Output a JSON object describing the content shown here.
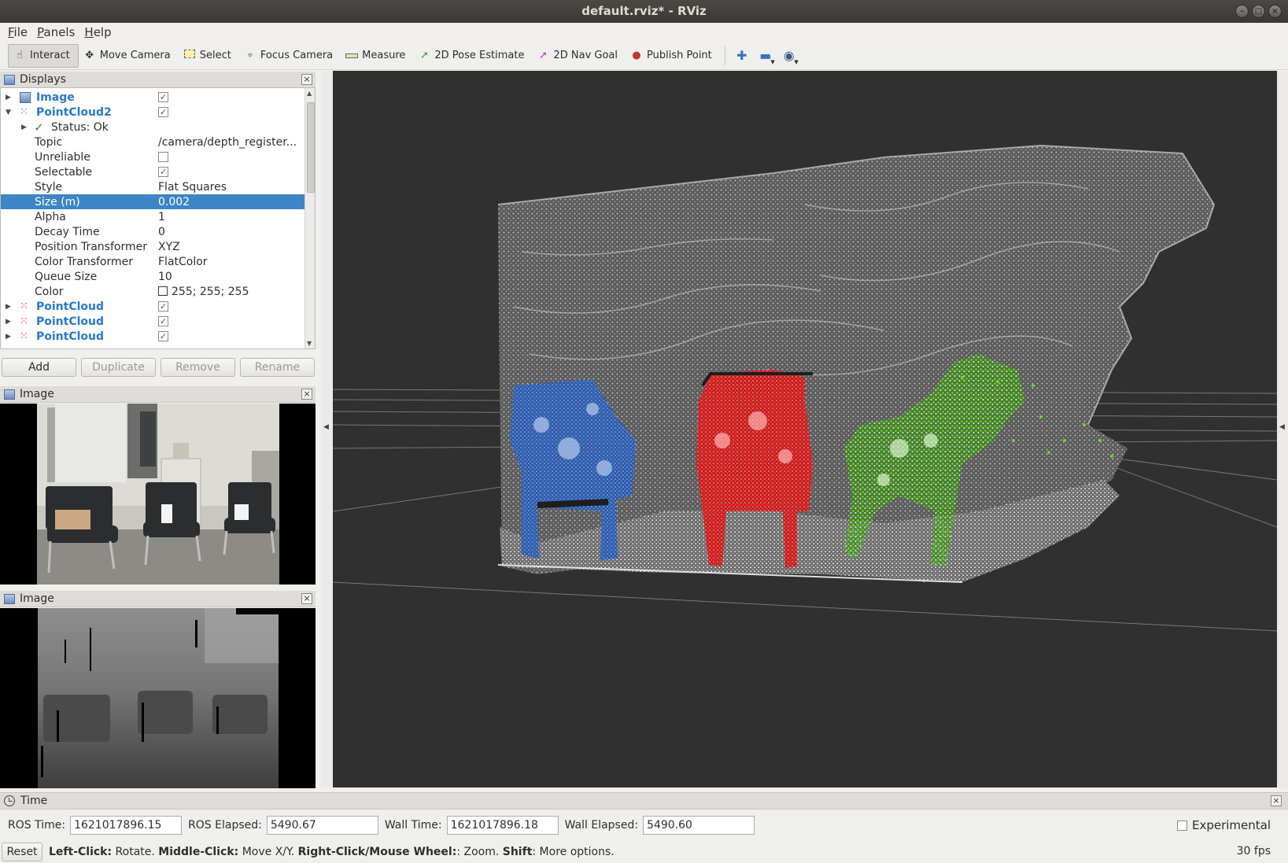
{
  "window": {
    "title": "default.rviz* - RViz"
  },
  "menu": [
    "File",
    "Panels",
    "Help"
  ],
  "toolbar": {
    "tools": [
      {
        "label": "Interact",
        "icon": "hand-icon"
      },
      {
        "label": "Move Camera",
        "icon": "move-camera-icon"
      },
      {
        "label": "Select",
        "icon": "select-box-icon"
      },
      {
        "label": "Focus Camera",
        "icon": "crosshair-icon"
      },
      {
        "label": "Measure",
        "icon": "ruler-icon"
      },
      {
        "label": "2D Pose Estimate",
        "icon": "green-arrow-icon"
      },
      {
        "label": "2D Nav Goal",
        "icon": "pink-arrow-icon"
      },
      {
        "label": "Publish Point",
        "icon": "map-pin-icon"
      }
    ]
  },
  "displays": {
    "title": "Displays",
    "rows": [
      {
        "name": "Image",
        "checked": true
      },
      {
        "name": "PointCloud2",
        "checked": true
      },
      {
        "name": "Status: Ok"
      },
      {
        "name": "Topic",
        "value": "/camera/depth_register..."
      },
      {
        "name": "Unreliable",
        "checked": false
      },
      {
        "name": "Selectable",
        "checked": true
      },
      {
        "name": "Style",
        "value": "Flat Squares"
      },
      {
        "name": "Size (m)",
        "value": "0.002"
      },
      {
        "name": "Alpha",
        "value": "1"
      },
      {
        "name": "Decay Time",
        "value": "0"
      },
      {
        "name": "Position Transformer",
        "value": "XYZ"
      },
      {
        "name": "Color Transformer",
        "value": "FlatColor"
      },
      {
        "name": "Queue Size",
        "value": "10"
      },
      {
        "name": "Color",
        "value": "255; 255; 255"
      },
      {
        "name": "PointCloud",
        "checked": true
      },
      {
        "name": "PointCloud",
        "checked": true
      },
      {
        "name": "PointCloud",
        "checked": true
      }
    ],
    "buttons": [
      "Add",
      "Duplicate",
      "Remove",
      "Rename"
    ]
  },
  "image_panels": [
    "Image",
    "Image"
  ],
  "time": {
    "title": "Time",
    "ros_time_label": "ROS Time:",
    "ros_time": "1621017896.15",
    "ros_elapsed_label": "ROS Elapsed:",
    "ros_elapsed": "5490.67",
    "wall_time_label": "Wall Time:",
    "wall_time": "1621017896.18",
    "wall_elapsed_label": "Wall Elapsed:",
    "wall_elapsed": "5490.60",
    "experimental_label": "Experimental"
  },
  "status": {
    "reset": "Reset",
    "help": [
      {
        "b": "Left-Click:",
        "t": " Rotate. "
      },
      {
        "b": "Middle-Click:",
        "t": " Move X/Y. "
      },
      {
        "b": "Right-Click/Mouse Wheel:",
        "t": ": Zoom. "
      },
      {
        "b": "Shift",
        "t": ": More options."
      }
    ],
    "fps": "30 fps"
  },
  "colors": {
    "selection": "#3d85c6",
    "viewport_bg": "#303030",
    "cloud_blue": "#3a6cc0",
    "cloud_red": "#e52a2a",
    "cloud_green": "#63d22a"
  }
}
